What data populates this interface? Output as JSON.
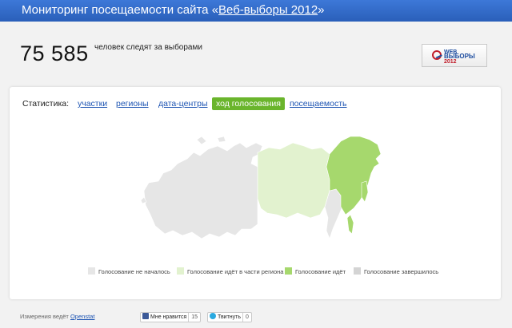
{
  "header": {
    "title_prefix": "Мониторинг посещаемости сайта «",
    "title_link": "Веб-выборы 2012",
    "title_suffix": "»"
  },
  "counter": {
    "value": "75 585",
    "label": "человек следят за выборами"
  },
  "logo": {
    "line1": "WEB",
    "line2": "ВЫБОРЫ",
    "line3": "2012"
  },
  "stats": {
    "label": "Статистика:",
    "tabs": [
      {
        "label": "участки",
        "active": false
      },
      {
        "label": "регионы",
        "active": false
      },
      {
        "label": "дата-центры",
        "active": false
      },
      {
        "label": "ход голосования",
        "active": true
      },
      {
        "label": "посещаемость",
        "active": false
      }
    ]
  },
  "legend": [
    {
      "label": "Голосование не началось",
      "color": "#e6e6e6"
    },
    {
      "label": "Голосование идёт в части региона",
      "color": "#e2f2cf"
    },
    {
      "label": "Голосование идёт",
      "color": "#a6d86d"
    },
    {
      "label": "Голосование завершилось",
      "color": "#d4d4d4"
    }
  ],
  "map": {
    "not_started_color": "#e6e6e6",
    "partial_color": "#e2f2cf",
    "active_color": "#a6d86d"
  },
  "footer": {
    "measured_by": "Измерения ведёт",
    "provider": "Openstat",
    "like_label": "Мне нравится",
    "like_count": "15",
    "tweet_label": "Твитнуть",
    "tweet_count": "0"
  }
}
